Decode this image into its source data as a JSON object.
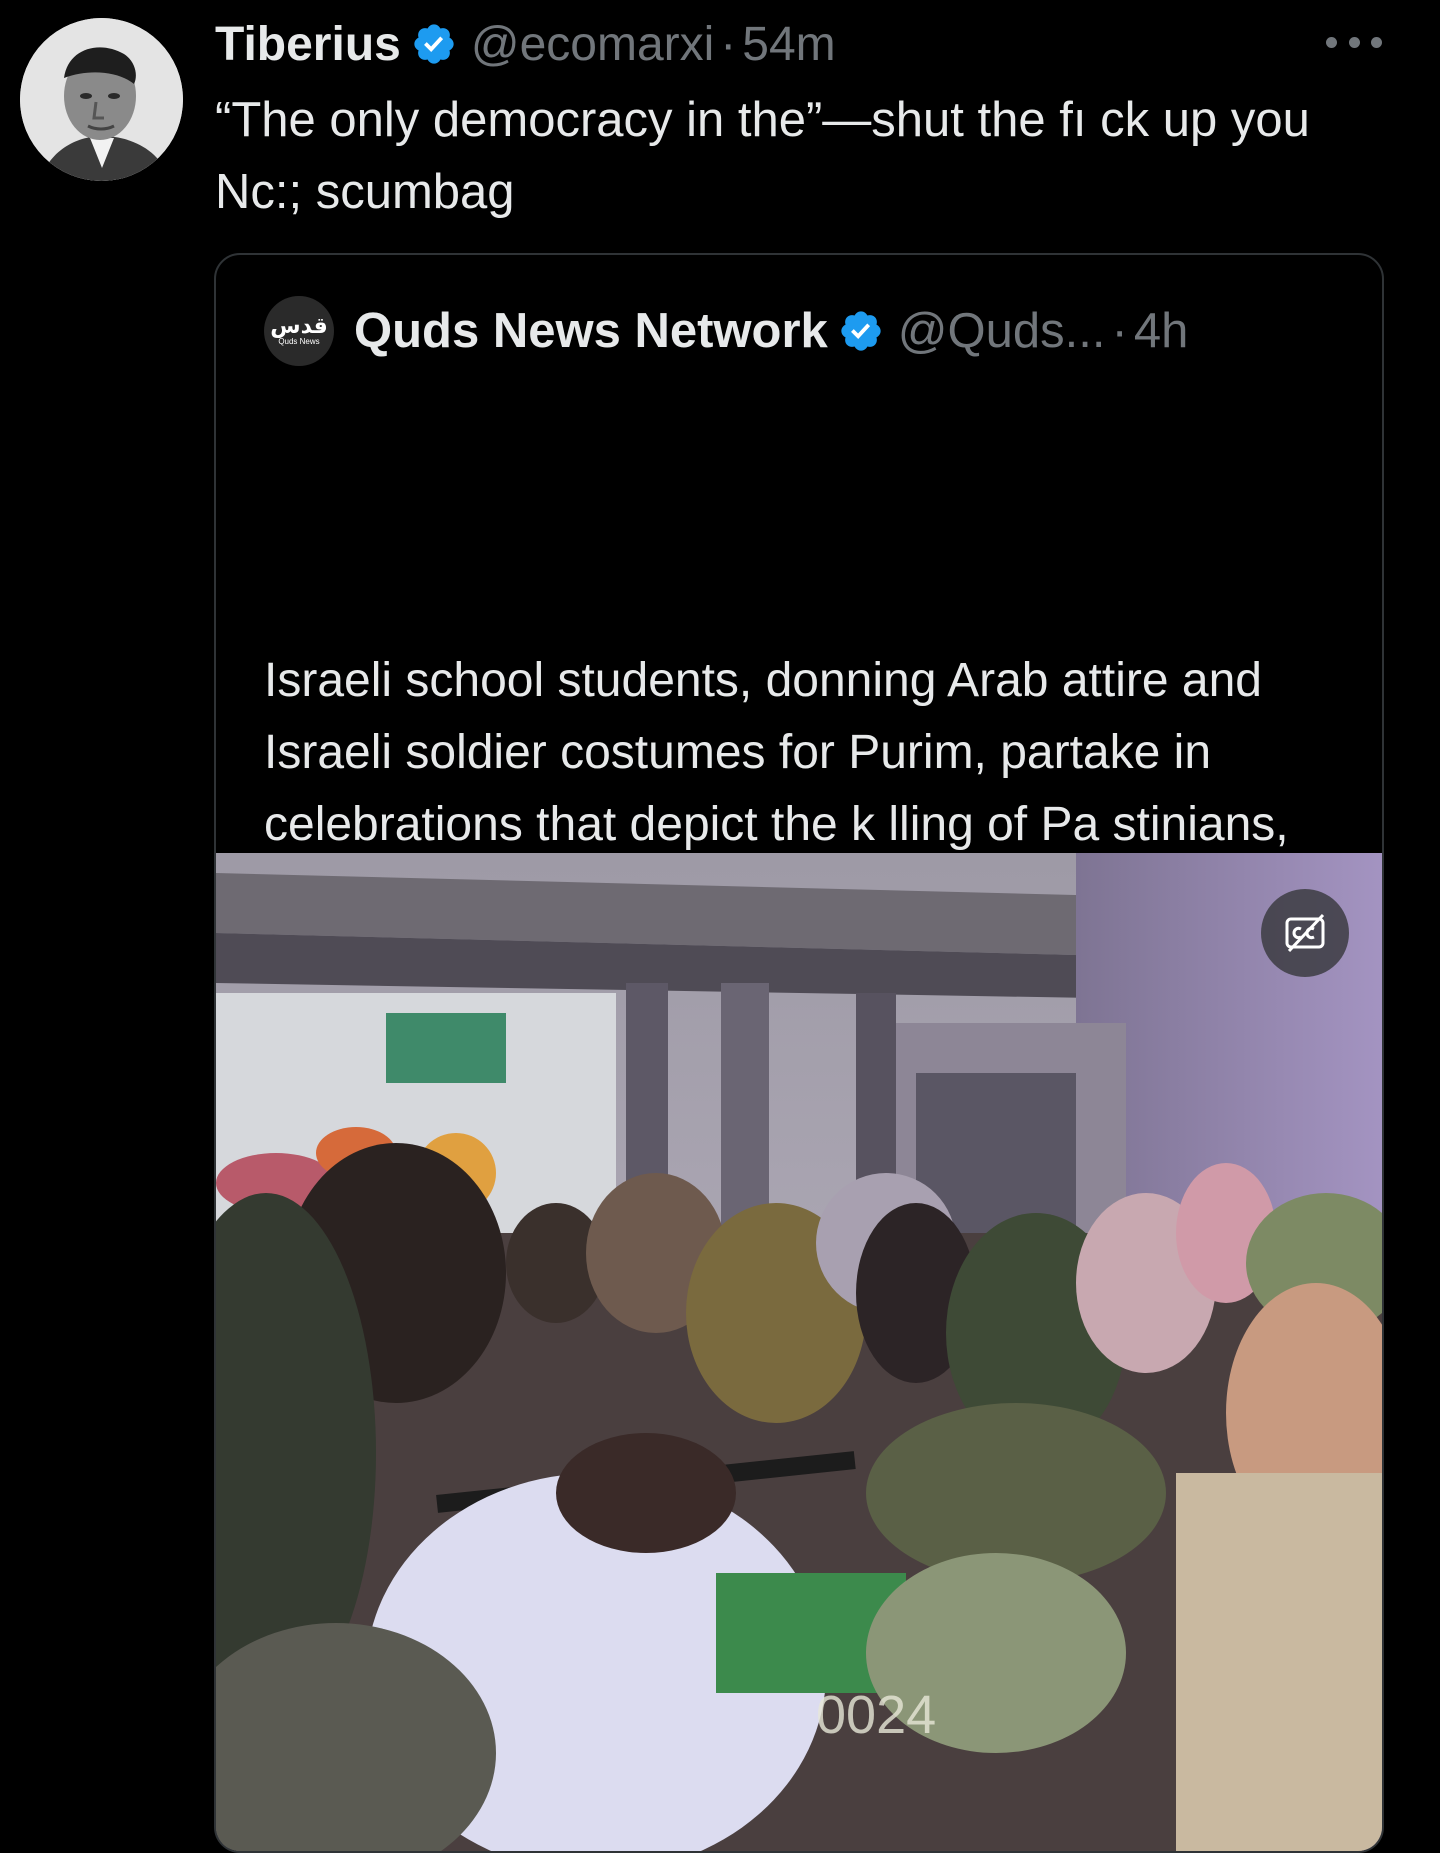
{
  "tweet": {
    "display_name": "Tiberius",
    "handle": "@ecomarxi",
    "separator": "·",
    "time": "54m",
    "text": "“The only democracy in the”—shut the fı ck up you Nc:; scumbag"
  },
  "quoted": {
    "avatar_text": "قدس",
    "avatar_subtext": "Quds News",
    "display_name": "Quds News Network",
    "handle": "@Quds...",
    "separator": "·",
    "time": "4h",
    "text": "Israeli school students, donning Arab attire and Israeli soldier costumes for Purim, partake in celebrations that depict the k lling of Pa stinians, accompanied by the streaming of g ocidal and racist music in schoolyards."
  },
  "media": {
    "overlay_text": "0024"
  },
  "colors": {
    "background": "#000000",
    "text": "#e7e9ea",
    "muted": "#71767b",
    "verified": "#1d9bf0",
    "border": "#2f3336"
  },
  "icons": {
    "verified": "verified-badge-icon",
    "more": "more-options-icon",
    "captions": "closed-captions-off-icon"
  }
}
